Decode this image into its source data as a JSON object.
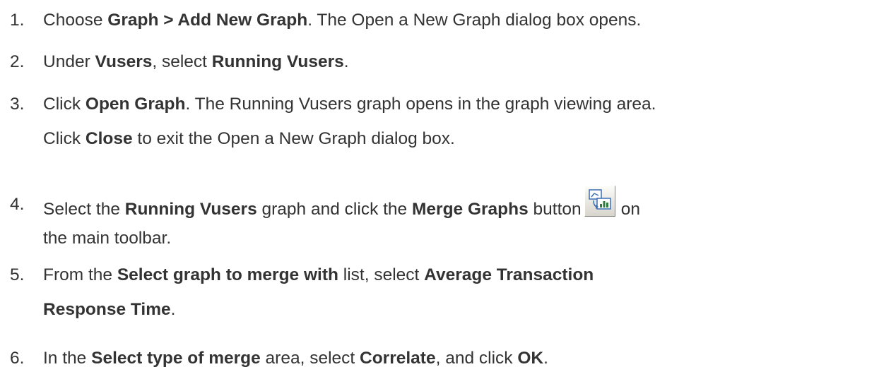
{
  "steps": [
    {
      "number": "1.",
      "lines": [
        [
          {
            "text": "Choose ",
            "bold": false
          },
          {
            "text": "Graph > Add New Graph",
            "bold": true
          },
          {
            "text": ". The Open a New Graph dialog box opens.",
            "bold": false
          }
        ]
      ]
    },
    {
      "number": "2.",
      "lines": [
        [
          {
            "text": "Under ",
            "bold": false
          },
          {
            "text": "Vusers",
            "bold": true
          },
          {
            "text": ", select ",
            "bold": false
          },
          {
            "text": "Running Vusers",
            "bold": true
          },
          {
            "text": ".",
            "bold": false
          }
        ]
      ]
    },
    {
      "number": "3.",
      "lines": [
        [
          {
            "text": "Click ",
            "bold": false
          },
          {
            "text": "Open Graph",
            "bold": true
          },
          {
            "text": ". The Running Vusers graph opens in the graph viewing area.",
            "bold": false
          }
        ],
        [
          {
            "text": "Click ",
            "bold": false
          },
          {
            "text": "Close",
            "bold": true
          },
          {
            "text": " to exit the Open a New Graph dialog box.",
            "bold": false
          }
        ]
      ]
    },
    {
      "number": "4.",
      "lines": [
        [
          {
            "text": "Select the ",
            "bold": false
          },
          {
            "text": "Running Vusers",
            "bold": true
          },
          {
            "text": " graph and click the ",
            "bold": false
          },
          {
            "text": "Merge Graphs",
            "bold": true
          },
          {
            "text": " button",
            "bold": false
          },
          {
            "icon": "merge-graphs-icon"
          },
          {
            "text": "on",
            "bold": false
          }
        ],
        [
          {
            "text": "the main toolbar.",
            "bold": false
          }
        ]
      ]
    },
    {
      "number": "5.",
      "lines": [
        [
          {
            "text": "From the ",
            "bold": false
          },
          {
            "text": "Select graph to merge with",
            "bold": true
          },
          {
            "text": " list, select ",
            "bold": false
          },
          {
            "text": "Average Transaction",
            "bold": true
          }
        ],
        [
          {
            "text": "Response Time",
            "bold": true
          },
          {
            "text": ".",
            "bold": false
          }
        ]
      ]
    },
    {
      "number": "6.",
      "lines": [
        [
          {
            "text": "In the ",
            "bold": false
          },
          {
            "text": "Select type of merge",
            "bold": true
          },
          {
            "text": " area, select ",
            "bold": false
          },
          {
            "text": "Correlate",
            "bold": true
          },
          {
            "text": ", and click ",
            "bold": false
          },
          {
            "text": "OK",
            "bold": true
          },
          {
            "text": ".",
            "bold": false
          }
        ]
      ]
    }
  ]
}
